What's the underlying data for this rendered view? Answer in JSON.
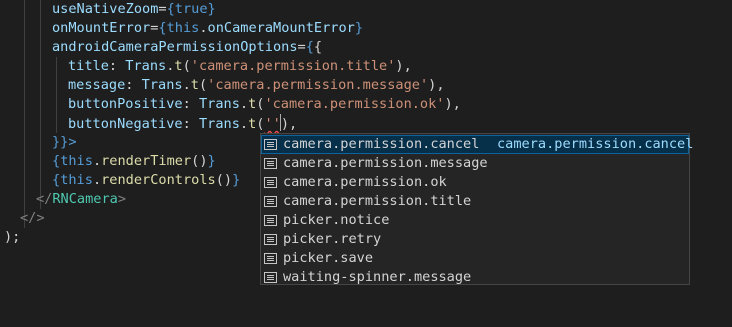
{
  "editor": {
    "lines": [
      {
        "segments": [
          "useNativeZoom",
          "=",
          "{",
          "true",
          "}"
        ]
      },
      {
        "segments": [
          "onMountError",
          "=",
          "{",
          "this",
          ".",
          "onCameraMountError",
          "}"
        ]
      },
      {
        "segments": [
          "androidCameraPermissionOptions",
          "=",
          "{",
          "{"
        ]
      },
      {
        "segments": [
          "title",
          ": ",
          "Trans",
          ".",
          "t",
          "(",
          "'camera.permission.title'",
          "),"
        ]
      },
      {
        "segments": [
          "message",
          ": ",
          "Trans",
          ".",
          "t",
          "(",
          "'camera.permission.message'",
          "),"
        ]
      },
      {
        "segments": [
          "buttonPositive",
          ": ",
          "Trans",
          ".",
          "t",
          "(",
          "'camera.permission.ok'",
          "),"
        ]
      },
      {
        "segments": [
          "buttonNegative",
          ": ",
          "Trans",
          ".",
          "t",
          "(",
          "''",
          "),"
        ]
      },
      {
        "segments": [
          "}}>"
        ]
      },
      {
        "segments": [
          "{",
          "this",
          ".",
          "renderTimer",
          "()",
          "}"
        ]
      },
      {
        "segments": [
          "{",
          "this",
          ".",
          "renderControls",
          "()",
          "}"
        ]
      },
      {
        "segments": [
          "</",
          "RNCamera",
          ">"
        ]
      },
      {
        "segments": [
          "</",
          ">"
        ]
      },
      {
        "segments": [
          ");"
        ]
      }
    ]
  },
  "suggestions": {
    "icon": "text-symbol-icon",
    "items": [
      {
        "label": "camera.permission.cancel",
        "detail": "camera.permission.cancel",
        "selected": true
      },
      {
        "label": "camera.permission.message",
        "detail": "",
        "selected": false
      },
      {
        "label": "camera.permission.ok",
        "detail": "",
        "selected": false
      },
      {
        "label": "camera.permission.title",
        "detail": "",
        "selected": false
      },
      {
        "label": "picker.notice",
        "detail": "",
        "selected": false
      },
      {
        "label": "picker.retry",
        "detail": "",
        "selected": false
      },
      {
        "label": "picker.save",
        "detail": "",
        "selected": false
      },
      {
        "label": "waiting-spinner.message",
        "detail": "",
        "selected": false
      }
    ]
  },
  "colors": {
    "background": "#1e1e1e",
    "attribute": "#9cdcfe",
    "keyword": "#569cd6",
    "function": "#dcdcaa",
    "string": "#ce9178",
    "tag": "#4ec9b0",
    "selection": "#062f4a"
  }
}
